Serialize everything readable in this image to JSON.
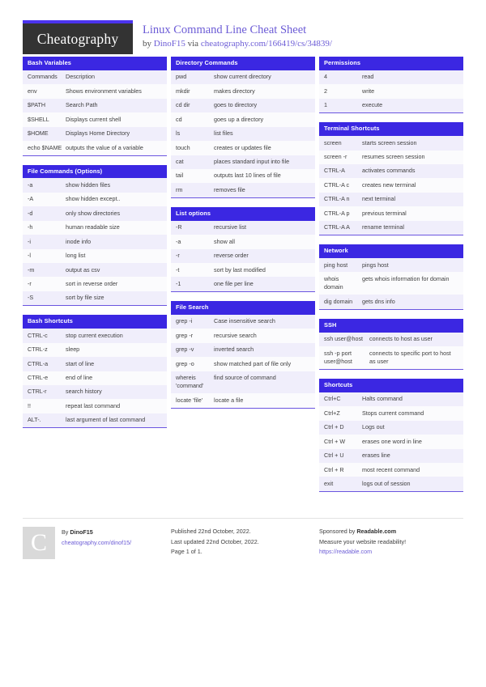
{
  "brand": {
    "logo_text": "Cheatography",
    "accent_color": "#4b33ee",
    "header_color": "#3b27e2",
    "link_color": "#6c5cd6"
  },
  "header": {
    "title": "Linux Command Line Cheat Sheet",
    "byline_prefix": "by ",
    "author": "DinoF15",
    "byline_via": " via ",
    "source_url": "cheatography.com/166419/cs/34839/"
  },
  "columns": [
    {
      "cards": [
        {
          "title": "Bash Variables",
          "rows": [
            [
              "Commands",
              "Description"
            ],
            [
              "env",
              "Shows environment variables"
            ],
            [
              "$PATH",
              "Search Path"
            ],
            [
              "$SHELL",
              "Displays current shell"
            ],
            [
              "$HOME",
              "Displays Home Directory"
            ],
            [
              "echo $NAME",
              "outputs the value of a variable"
            ]
          ]
        },
        {
          "title": "File Commands (Options)",
          "rows": [
            [
              "-a",
              "show hidden files"
            ],
            [
              "-A",
              "show hidden except.."
            ],
            [
              "-d",
              "only show directories"
            ],
            [
              "-h",
              "human readable size"
            ],
            [
              "-i",
              "inode info"
            ],
            [
              "-l",
              "long list"
            ],
            [
              "-m",
              "output as csv"
            ],
            [
              "-r",
              "sort in reverse order"
            ],
            [
              "-S",
              "sort by file size"
            ]
          ]
        },
        {
          "title": "Bash Shortcuts",
          "rows": [
            [
              "CTRL-c",
              "stop current execution"
            ],
            [
              "CTRL-z",
              "sleep"
            ],
            [
              "CTRL-a",
              "start of line"
            ],
            [
              "CTRL-e",
              "end of line"
            ],
            [
              "CTRL-r",
              "search history"
            ],
            [
              "!!",
              "repeat last command"
            ],
            [
              "ALT-.",
              "last argument of last command"
            ]
          ]
        }
      ]
    },
    {
      "cards": [
        {
          "title": "Directory Commands",
          "rows": [
            [
              "pwd",
              "show current directory"
            ],
            [
              "mkdir",
              "makes directory"
            ],
            [
              "cd dir",
              "goes to directory"
            ],
            [
              "cd",
              "goes up a directory"
            ],
            [
              "ls",
              "list files"
            ],
            [
              "touch",
              "creates or updates file"
            ],
            [
              "cat",
              "places standard input into file"
            ],
            [
              "tail",
              "outputs last 10 lines of file"
            ],
            [
              "rm",
              "removes file"
            ]
          ]
        },
        {
          "title": "List options",
          "rows": [
            [
              "-R",
              "recursive list"
            ],
            [
              "-a",
              "show all"
            ],
            [
              "-r",
              "reverse order"
            ],
            [
              "-t",
              "sort by last modified"
            ],
            [
              "-1",
              "one file per line"
            ]
          ]
        },
        {
          "title": "File Search",
          "rows": [
            [
              "grep -i",
              "Case insensitive search"
            ],
            [
              "grep -r",
              "recursive search"
            ],
            [
              "grep -v",
              "inverted search"
            ],
            [
              "grep -o",
              "show matched part of file only"
            ],
            [
              "whereis 'command'",
              "find source of command"
            ],
            [
              "locate 'file'",
              "locate a file"
            ]
          ]
        }
      ]
    },
    {
      "cards": [
        {
          "title": "Permissions",
          "rows": [
            [
              "4",
              "read"
            ],
            [
              "2",
              "write"
            ],
            [
              "1",
              "execute"
            ]
          ]
        },
        {
          "title": "Terminal Shortcuts",
          "rows": [
            [
              "screen",
              "starts screen session"
            ],
            [
              "screen -r",
              "resumes screen session"
            ],
            [
              "CTRL-A",
              "activates commands"
            ],
            [
              "CTRL-A c",
              "creates new terminal"
            ],
            [
              "CTRL-A n",
              "next terminal"
            ],
            [
              "CTRL-A p",
              "previous terminal"
            ],
            [
              "CTRL-A A",
              "rename terminal"
            ]
          ]
        },
        {
          "title": "Network",
          "rows": [
            [
              "ping host",
              "pings host"
            ],
            [
              "whois domain",
              "gets whois information for domain"
            ],
            [
              "dig domain",
              "gets dns info"
            ]
          ]
        },
        {
          "title": "SSH",
          "rows": [
            [
              "ssh user@host",
              "connects to host as user"
            ],
            [
              "ssh -p port user@host",
              "connects to specific port to host as user"
            ]
          ]
        },
        {
          "title": "Shortcuts",
          "rows": [
            [
              "Ctrl+C",
              "Halts command"
            ],
            [
              "Ctrl+Z",
              "Stops current command"
            ],
            [
              "Ctrl + D",
              "Logs out"
            ],
            [
              "Ctrl + W",
              "erases one word in line"
            ],
            [
              "Ctrl + U",
              "erases line"
            ],
            [
              "Ctrl + R",
              "most recent command"
            ],
            [
              "exit",
              "logs out of session"
            ]
          ]
        }
      ]
    }
  ],
  "footer": {
    "badge_letter": "C",
    "by_label": "By ",
    "author": "DinoF15",
    "author_url": "cheatography.com/dinof15/",
    "published": "Published 22nd October, 2022.",
    "last_updated": "Last updated 22nd October, 2022.",
    "page": "Page 1 of 1.",
    "sponsor_prefix": "Sponsored by ",
    "sponsor_name": "Readable.com",
    "sponsor_tagline": "Measure your website readability!",
    "sponsor_url": "https://readable.com"
  }
}
